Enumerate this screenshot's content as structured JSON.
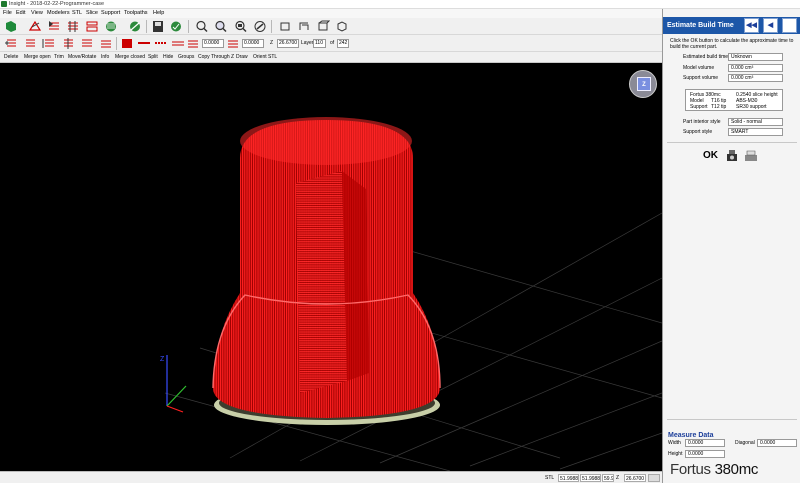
{
  "app": {
    "title": "Insight - 2018-02-22-Programmer-case"
  },
  "menu": [
    "File",
    "Edit",
    "View",
    "Modelers",
    "STL",
    "Slice",
    "Support",
    "Toolpaths",
    "Help"
  ],
  "toolbar2": {
    "field1": "0.0000",
    "field2": "0.0000",
    "z_label": "Z",
    "z_value": "26.6700",
    "layer_label": "Layer",
    "layer_value": "110",
    "of_label": "of",
    "of_value": "242"
  },
  "actions": [
    "Delete",
    "Merge open",
    "Trim",
    "Move/Rotate",
    "Info",
    "Merge closed",
    "Split",
    "Hide",
    "Groups",
    "Copy Through Z",
    "Draw",
    "Orient STL"
  ],
  "viewport": {
    "background": "#000000",
    "model_color": "#ff1a1a",
    "nav_cube_label": "Z",
    "axis_z_label": "Z"
  },
  "status": {
    "stl_label": "STL",
    "x": "51.9988",
    "y": "51.9988",
    "y2": "59.9999",
    "z_label": "Z",
    "z_value": "26.6700"
  },
  "panel": {
    "title": "Estimate Build Time",
    "nav_prev": "◀◀",
    "nav_back": "◀",
    "description": "Click the OK button to calculate the approximate time to build the current part.",
    "rows": [
      {
        "label": "Estimated build time",
        "value": "Unknown"
      },
      {
        "label": "Model volume",
        "value": "0.000 cm³"
      },
      {
        "label": "Support volume",
        "value": "0.000 cm³"
      }
    ],
    "info": {
      "machine": "Fortus 380mc",
      "slice": "0.2540 slice height",
      "model_label": "Model",
      "model_tip": "T16 tip",
      "model_material": "ABS-M30",
      "support_label": "Support",
      "support_tip": "T12 tip",
      "support_material": "SR30 support"
    },
    "interior_label": "Part interior style",
    "interior_value": "Solid - normal",
    "support_style_label": "Support style",
    "support_style_value": "SMART",
    "ok_label": "OK"
  },
  "measure": {
    "title": "Measure Data",
    "width_label": "Width",
    "width_value": "0.0000",
    "diagonal_label": "Diagonal",
    "diagonal_value": "0.0000",
    "height_label": "Height",
    "height_value": "0.0000"
  },
  "brand": {
    "prefix": "Fortus ",
    "model": "380mc"
  }
}
